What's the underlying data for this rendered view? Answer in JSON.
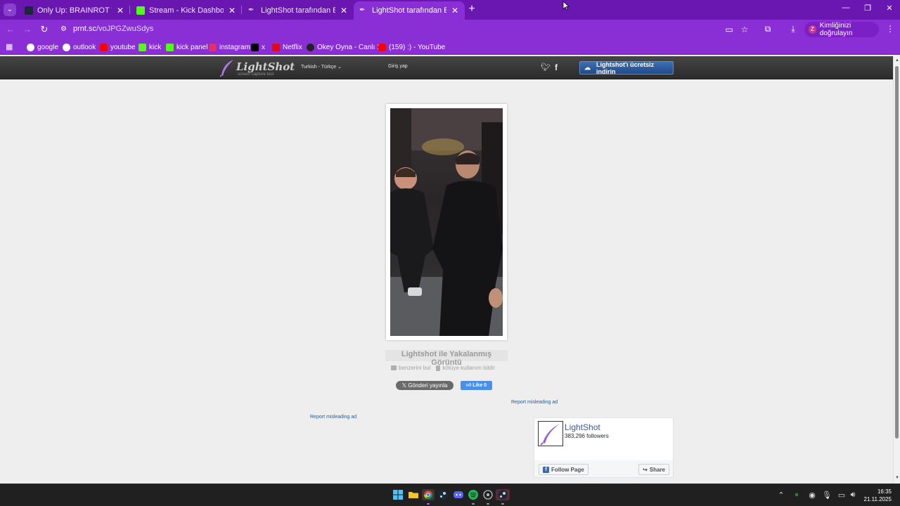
{
  "browser": {
    "tabs": [
      {
        "label": "Only Up: BRAINROT TOGETHER",
        "active": false,
        "favicon": "steam-icon"
      },
      {
        "label": "Stream - Kick Dashboard",
        "active": false,
        "favicon": "kick-icon"
      },
      {
        "label": "LightShot tarafından Ekran Görü",
        "active": false,
        "favicon": "lightshot-icon"
      },
      {
        "label": "LightShot tarafından Ekran Görü",
        "active": true,
        "favicon": "lightshot-icon"
      }
    ],
    "url_host": "prnt.sc",
    "url_path": "/voJPGZwuSdys",
    "profile_label": "Kimliğinizi doğrulayın",
    "profile_initial": "Z",
    "bookmarks": [
      {
        "label": "google",
        "favicon": "google-icon",
        "color": "#4285f4"
      },
      {
        "label": "outlook",
        "favicon": "outlook-icon",
        "color": "#2b7cd3"
      },
      {
        "label": "youtube",
        "favicon": "youtube-icon",
        "color": "#ff0000"
      },
      {
        "label": "kick",
        "favicon": "kick-icon",
        "color": "#53fc18"
      },
      {
        "label": "kick panel",
        "favicon": "kick-icon",
        "color": "#53fc18"
      },
      {
        "label": "instagram",
        "favicon": "instagram-icon",
        "color": "#e1306c"
      },
      {
        "label": "x",
        "favicon": "x-icon",
        "color": "#000000"
      },
      {
        "label": "Netflix",
        "favicon": "netflix-icon",
        "color": "#e50914"
      },
      {
        "label": "Okey Oyna - Canlı 1...",
        "favicon": "okey-icon",
        "color": "#222222"
      },
      {
        "label": "(159) :) - YouTube",
        "favicon": "youtube-icon",
        "color": "#ff0000"
      }
    ]
  },
  "header": {
    "logo_name": "LightShot",
    "logo_tagline": "screen capture tool",
    "language": "Turkish - Türkçe",
    "login": "Giriş yap",
    "download_button": "Lightshot'ı ücretsiz indirin"
  },
  "screenshot": {
    "caption": "Lightshot ile Yakalanmış Görüntü",
    "find_similar": "benzerini bul",
    "report_abuse": "kötüye kullanım bildir",
    "tweet_button": "Gönderi yayınla",
    "like_button": "Like 0",
    "report_ad_1": "Report misleading ad",
    "report_ad_2": "Report misleading ad"
  },
  "facebook": {
    "page_name": "LightShot",
    "followers": "383,296 followers",
    "follow_label": "Follow Page",
    "share_label": "Share"
  },
  "taskbar": {
    "time": "16:35",
    "date": "21.11.2025"
  },
  "colors": {
    "chrome_dark": "#6a16b0",
    "chrome": "#8a2ed6",
    "link": "#2d5a8c",
    "download": "#224a86"
  }
}
